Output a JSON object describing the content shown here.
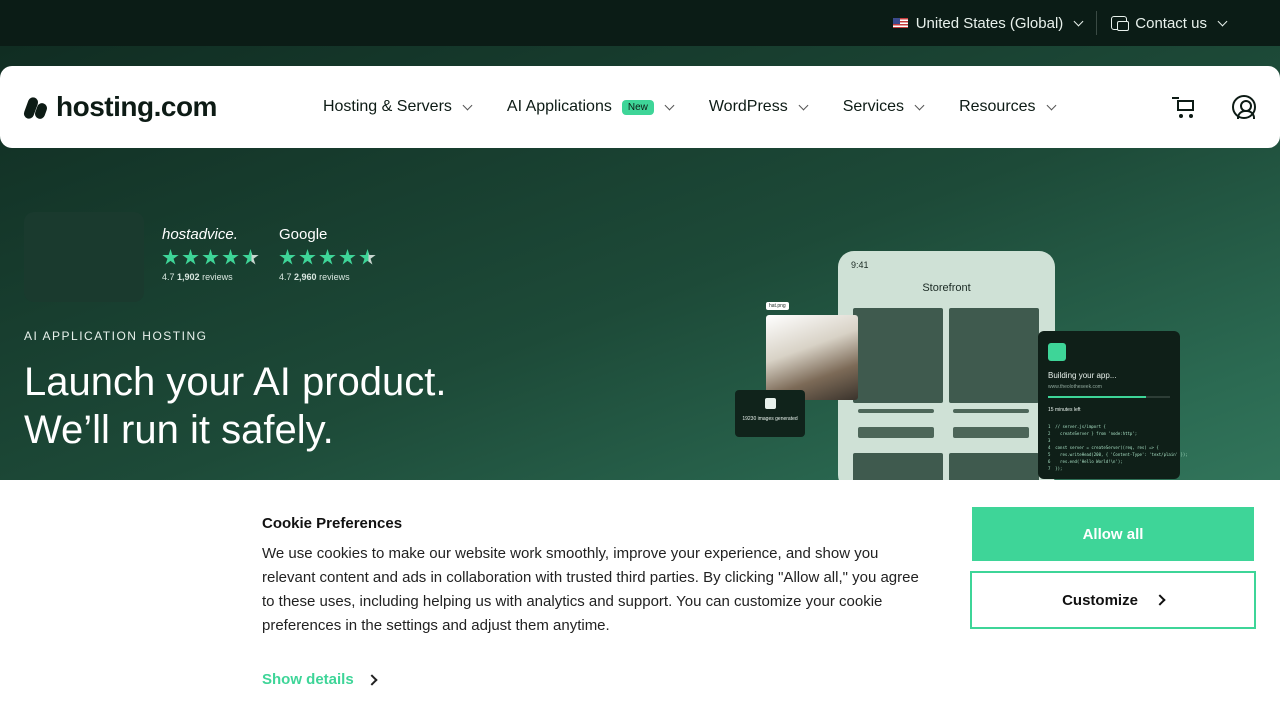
{
  "topbar": {
    "region": "United States (Global)",
    "contact": "Contact us"
  },
  "nav": {
    "logo_text": "hosting.com",
    "items": [
      {
        "label": "Hosting & Servers"
      },
      {
        "label": "AI Applications",
        "badge": "New"
      },
      {
        "label": "WordPress"
      },
      {
        "label": "Services"
      },
      {
        "label": "Resources"
      }
    ]
  },
  "hero": {
    "ratings": [
      {
        "brand": "hostadvice.",
        "score": "4.7",
        "count": "1,902",
        "suffix": "reviews"
      },
      {
        "brand": "Google",
        "score": "4.7",
        "count": "2,960",
        "suffix": "reviews"
      }
    ],
    "eyebrow": "AI APPLICATION HOSTING",
    "headline_line1": "Launch your AI product.",
    "headline_line2": "We’ll run it safely."
  },
  "mockup": {
    "phone_time": "9:41",
    "phone_title": "Storefront",
    "photo_tag": "hat.png",
    "gen_text": "19230 images generated",
    "build_title": "Building your app...",
    "build_url": "www.theolotheseek.com",
    "build_minutes": "15 minutes left",
    "code": "1  // server.js/import {\n2    createServer } from 'node:http';\n3\n4  const server = createServer((req, res) => {\n5    res.writeHead(200, { 'Content-Type': 'text/plain' });\n6    res.end('Hello World!\\n');\n7  });"
  },
  "cookie": {
    "title": "Cookie Preferences",
    "body": "We use cookies to make our website work smoothly, improve your experience, and show you relevant content and ads in collaboration with trusted third parties. By clicking \"Allow all,\" you agree to these uses, including helping us with analytics and support. You can customize your cookie preferences in the settings and adjust them anytime.",
    "details_label": "Show details",
    "allow_label": "Allow all",
    "customize_label": "Customize"
  },
  "colors": {
    "accent": "#3ed598",
    "topbar_bg": "#0b1c16",
    "hero_bg": "#1d4a38"
  }
}
